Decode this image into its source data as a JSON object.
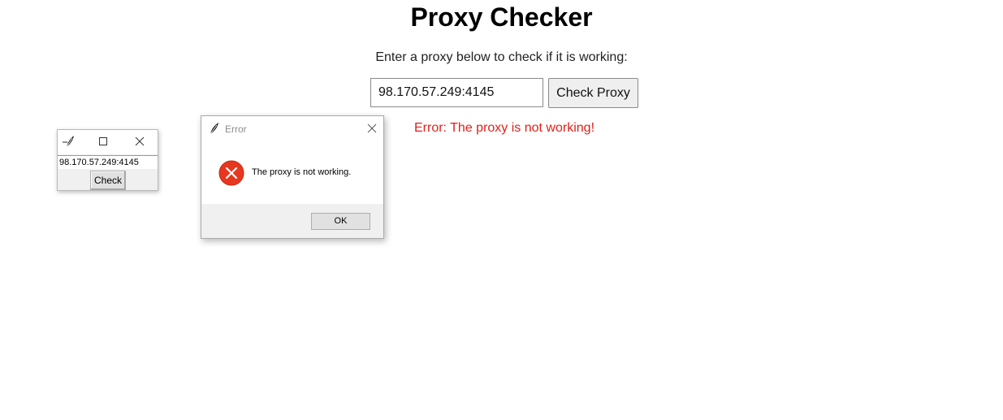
{
  "page": {
    "title": "Proxy Checker",
    "instruction": "Enter a proxy below to check if it is working:",
    "proxy_input_value": "98.170.57.249:4145",
    "check_button_label": "Check Proxy",
    "error_message": "Error: The proxy is not working!"
  },
  "mini_window": {
    "icon": "feather-icon",
    "entry_value": "98.170.57.249:4145",
    "check_button_label": "Check"
  },
  "error_dialog": {
    "title": "Error",
    "icon": "error-icon",
    "message": "The proxy is not working.",
    "ok_label": "OK"
  },
  "colors": {
    "error_text": "#e0201a",
    "error_icon": "#e8371f"
  }
}
